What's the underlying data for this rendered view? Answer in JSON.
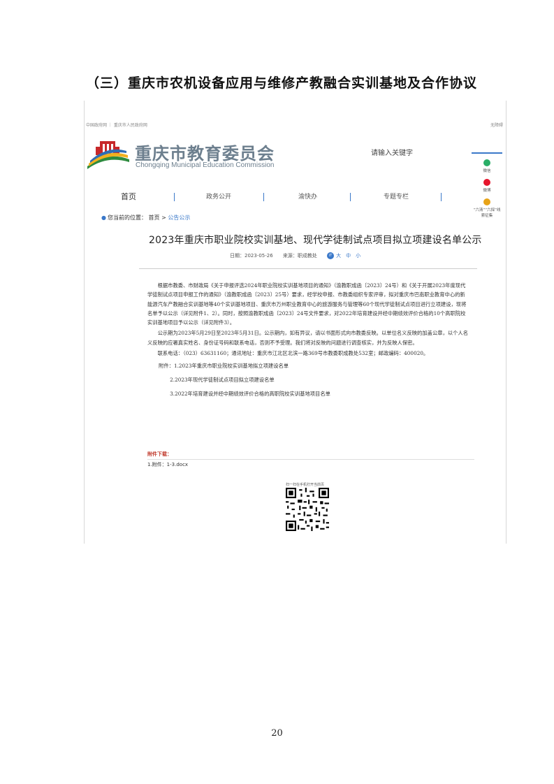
{
  "document": {
    "heading": "（三）重庆市农机设备应用与维修产教融合实训基地及合作协议",
    "page_number": "20"
  },
  "website": {
    "topbar": {
      "left": "中国政府网 ｜ 重庆市人民政府网",
      "right": "无障碍"
    },
    "brand": {
      "name_cn": "重庆市教育委员会",
      "name_en": "Chongqing Municipal Education Commission"
    },
    "search": {
      "placeholder": "请输入关键字"
    },
    "side": [
      {
        "label": "微信",
        "icon": "wechat-icon",
        "color": "#2aae67"
      },
      {
        "label": "微博",
        "icon": "weibo-icon",
        "color": "#e6162d"
      },
      {
        "label": "“六清”“六探”线索征集",
        "icon": "clue-icon",
        "color": "#e8a317"
      }
    ],
    "nav": [
      "首页",
      "政务公开",
      "渝快办",
      "专题专栏"
    ],
    "breadcrumb": {
      "prefix": "您当前的位置：",
      "home": "首页",
      "sep": ">",
      "current": "公告公示"
    },
    "article": {
      "title": "2023年重庆市职业院校实训基地、现代学徒制试点项目拟立项建设名单公示",
      "date_label": "日期：",
      "date": "2023-05-26",
      "source_label": "来源：",
      "source": "职成教处",
      "font_sizes": [
        "大",
        "中",
        "小"
      ],
      "paragraphs": [
        "根据市教委、市财政局《关于申报评选2024年职业院校实训基地项目的通知》（渝教职成函〔2023〕24号）和《关于开展2023年度现代学徒制试点项目申报工作的通知》（渝教职成函〔2023〕25号）要求，经学校申报、市教委组织专家评审，拟对重庆市巴南职业教育中心的新能源汽车产教融合实训基地等40个实训基地项目、重庆市万州职业教育中心的旅游服务与管理等60个现代学徒制试点项目进行立项建设，现将名单予以公示（详见附件1、2）。同时，按照渝教职成函〔2023〕24号文件要求，对2022年培育建设并经中期绩效评价合格的10个高职院校实训基地项目予以公示（详见附件3）。",
        "公示期为2023年5月29日至2023年5月31日。公示期内，如有异议，请以书面形式向市教委反映。以单位名义反映的加盖公章，以个人名义反映的应署真实姓名、身份证号码和联系电话，否则不予受理。我们将对反映的问题进行调查核实，并为反映人保密。",
        "联系电话：（023）63631160；通讯地址：重庆市江北区北滨一路369号市教委职成教处532室；邮政编码：400020。"
      ],
      "attachments_label": "附件：",
      "attachments": [
        "1.2023年重庆市职业院校实训基地拟立项建设名单",
        "2.2023年现代学徒制试点项目拟立项建设名单",
        "3.2022年培育建设并经中期绩效评价合格的高职院校实训基地项目名单"
      ],
      "download_label": "附件下载：",
      "download_file": "1.附件：1-3.docx",
      "qr_caption": "扫一扫在手机打开当前页"
    }
  }
}
